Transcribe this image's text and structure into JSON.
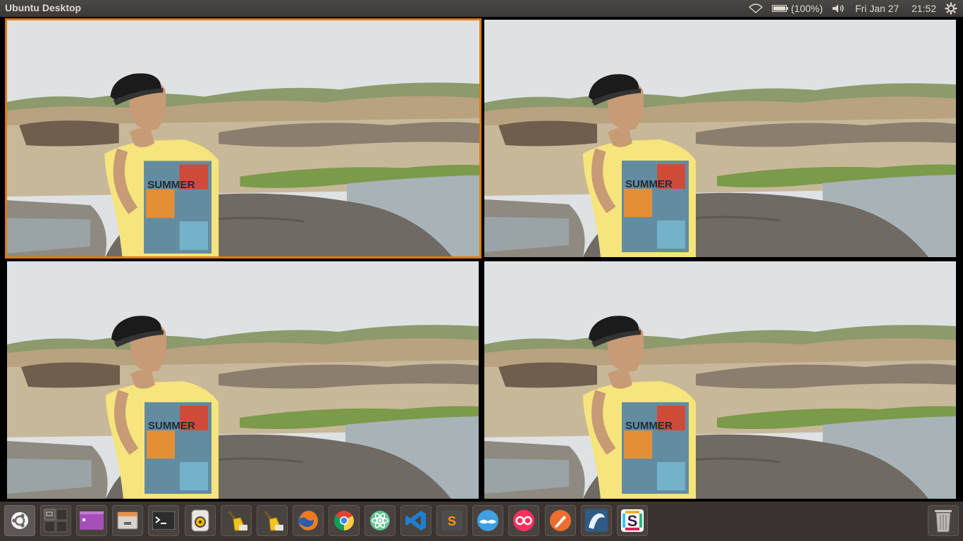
{
  "topbar": {
    "title": "Ubuntu Desktop",
    "battery_text": "(100%)",
    "date": "Fri Jan 27",
    "time": "21:52",
    "indicators": [
      "wifi-icon",
      "battery-icon",
      "volume-icon",
      "settings-gear-icon"
    ]
  },
  "workspaces": [
    {
      "name": "Workspace 1",
      "active": true
    },
    {
      "name": "Workspace 2",
      "active": false
    },
    {
      "name": "Workspace 3",
      "active": false
    },
    {
      "name": "Workspace 4",
      "active": false
    }
  ],
  "wallpaper": {
    "shirt_text": "SUMMER",
    "colors": {
      "sky": "#dfe2e4",
      "shirt": "#f6e47c",
      "rock": "#6f6a63",
      "water": "#a8b3b8",
      "grass": "#7b9a4a"
    }
  },
  "launcher": {
    "items": [
      {
        "name": "Dash Home",
        "icon": "ubuntu-logo-icon",
        "color": "#7a7470"
      },
      {
        "name": "Workspace Switcher",
        "icon": "workspace-switcher-icon",
        "color": "#4b4542"
      },
      {
        "name": "Purple App",
        "icon": "purple-window-icon",
        "color": "#8e3fa0"
      },
      {
        "name": "Files",
        "icon": "files-drawer-icon",
        "color": "#8a8580"
      },
      {
        "name": "Terminal",
        "icon": "terminal-icon",
        "color": "#2c2c2c"
      },
      {
        "name": "Rhythmbox",
        "icon": "speaker-icon",
        "color": "#b7b3ad"
      },
      {
        "name": "BleachBit",
        "icon": "broom-icon",
        "color": "#d8d0b8"
      },
      {
        "name": "BleachBit (root)",
        "icon": "broom-icon",
        "color": "#d8d0b8"
      },
      {
        "name": "Firefox",
        "icon": "firefox-icon",
        "color": "#e66000"
      },
      {
        "name": "Chrome",
        "icon": "chrome-icon",
        "color": "#dc4437"
      },
      {
        "name": "Atom",
        "icon": "atom-icon",
        "color": "#66c195"
      },
      {
        "name": "Visual Studio Code",
        "icon": "vscode-icon",
        "color": "#1e7fd0"
      },
      {
        "name": "Sublime Text",
        "icon": "sublime-icon",
        "color": "#4c4c4c"
      },
      {
        "name": "Mustache App",
        "icon": "mustache-icon",
        "color": "#3ea0e0"
      },
      {
        "name": "Flickr",
        "icon": "flickr-icon",
        "color": "#ff2f5e"
      },
      {
        "name": "Postman",
        "icon": "postman-icon",
        "color": "#ef6c2f"
      },
      {
        "name": "MySQL Workbench",
        "icon": "mysql-dolphin-icon",
        "color": "#2e5c86"
      },
      {
        "name": "Slack",
        "icon": "slack-icon",
        "color": "#f4f4f4"
      }
    ],
    "trash": {
      "name": "Trash",
      "icon": "trash-icon"
    }
  }
}
